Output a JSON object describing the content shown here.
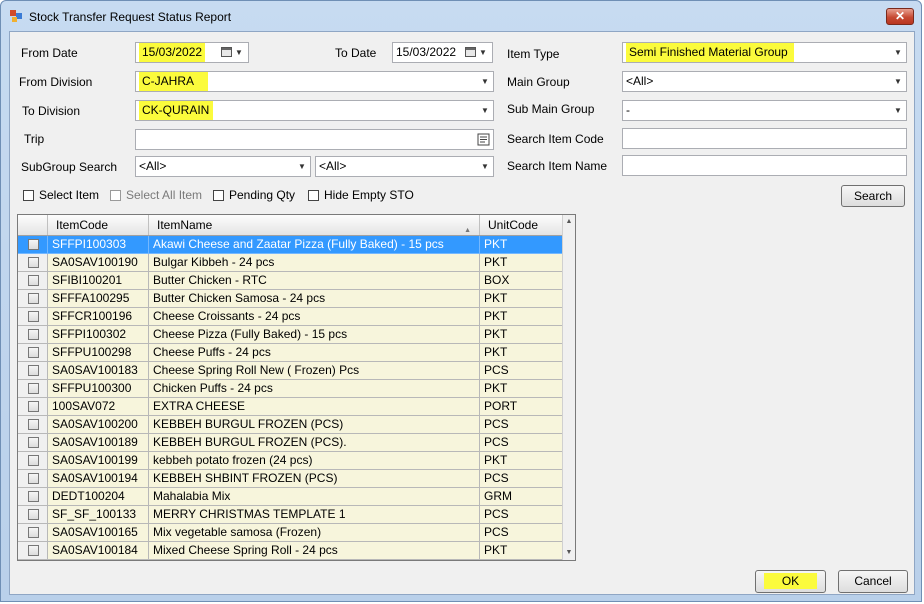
{
  "window": {
    "title": "Stock Transfer Request Status Report",
    "close_glyph": "✕"
  },
  "filters": {
    "from_date": {
      "label": "From Date",
      "value": "15/03/2022"
    },
    "to_date": {
      "label": "To Date",
      "value": "15/03/2022"
    },
    "from_division": {
      "label": "From Division",
      "value": "C-JAHRA"
    },
    "to_division": {
      "label": "To Division",
      "value": "CK-QURAIN"
    },
    "trip": {
      "label": "Trip",
      "value": ""
    },
    "subgroup_search": {
      "label": "SubGroup Search",
      "value1": "<All>",
      "value2": "<All>"
    },
    "item_type": {
      "label": "Item Type",
      "value": "Semi Finished Material Group"
    },
    "main_group": {
      "label": "Main Group",
      "value": "<All>"
    },
    "sub_main_group": {
      "label": "Sub Main Group",
      "value": "-"
    },
    "search_item_code": {
      "label": "Search Item Code",
      "value": ""
    },
    "search_item_name": {
      "label": "Search Item Name",
      "value": ""
    }
  },
  "options": {
    "select_item": "Select Item",
    "select_all_item": "Select All Item",
    "pending_qty": "Pending Qty",
    "hide_empty_sto": "Hide Empty STO"
  },
  "buttons": {
    "search": "Search",
    "ok": "OK",
    "cancel": "Cancel"
  },
  "grid": {
    "headers": {
      "item_code": "ItemCode",
      "item_name": "ItemName",
      "unit_code": "UnitCode"
    },
    "rows": [
      {
        "code": "SFFPI100303",
        "name": "Akawi Cheese and Zaatar Pizza (Fully Baked) - 15 pcs",
        "unit": "PKT"
      },
      {
        "code": "SA0SAV100190",
        "name": "Bulgar Kibbeh - 24 pcs",
        "unit": "PKT"
      },
      {
        "code": "SFIBI100201",
        "name": "Butter Chicken - RTC",
        "unit": "BOX"
      },
      {
        "code": "SFFFA100295",
        "name": "Butter Chicken Samosa - 24 pcs",
        "unit": "PKT"
      },
      {
        "code": "SFFCR100196",
        "name": "Cheese Croissants  - 24 pcs",
        "unit": "PKT"
      },
      {
        "code": "SFFPI100302",
        "name": "Cheese Pizza (Fully Baked) - 15 pcs",
        "unit": "PKT"
      },
      {
        "code": "SFFPU100298",
        "name": "Cheese Puffs - 24 pcs",
        "unit": "PKT"
      },
      {
        "code": "SA0SAV100183",
        "name": "Cheese Spring Roll New ( Frozen) Pcs",
        "unit": "PCS"
      },
      {
        "code": "SFFPU100300",
        "name": "Chicken Puffs - 24 pcs",
        "unit": "PKT"
      },
      {
        "code": "100SAV072",
        "name": "EXTRA CHEESE",
        "unit": "PORT"
      },
      {
        "code": "SA0SAV100200",
        "name": "KEBBEH BURGUL FROZEN (PCS)",
        "unit": "PCS"
      },
      {
        "code": "SA0SAV100189",
        "name": "KEBBEH BURGUL FROZEN (PCS).",
        "unit": "PCS"
      },
      {
        "code": "SA0SAV100199",
        "name": "kebbeh potato frozen (24 pcs)",
        "unit": "PKT"
      },
      {
        "code": "SA0SAV100194",
        "name": "KEBBEH SHBINT FROZEN (PCS)",
        "unit": "PCS"
      },
      {
        "code": "DEDT100204",
        "name": "Mahalabia Mix",
        "unit": "GRM"
      },
      {
        "code": "SF_SF_100133",
        "name": "MERRY CHRISTMAS TEMPLATE 1",
        "unit": "PCS"
      },
      {
        "code": "SA0SAV100165",
        "name": "Mix vegetable samosa (Frozen)",
        "unit": "PCS"
      },
      {
        "code": "SA0SAV100184",
        "name": "Mixed Cheese Spring Roll - 24 pcs",
        "unit": "PKT"
      }
    ]
  },
  "colors": {
    "highlight": "#fbfb3c",
    "selection": "#3399ff",
    "row_bg": "#f7f5dc"
  }
}
